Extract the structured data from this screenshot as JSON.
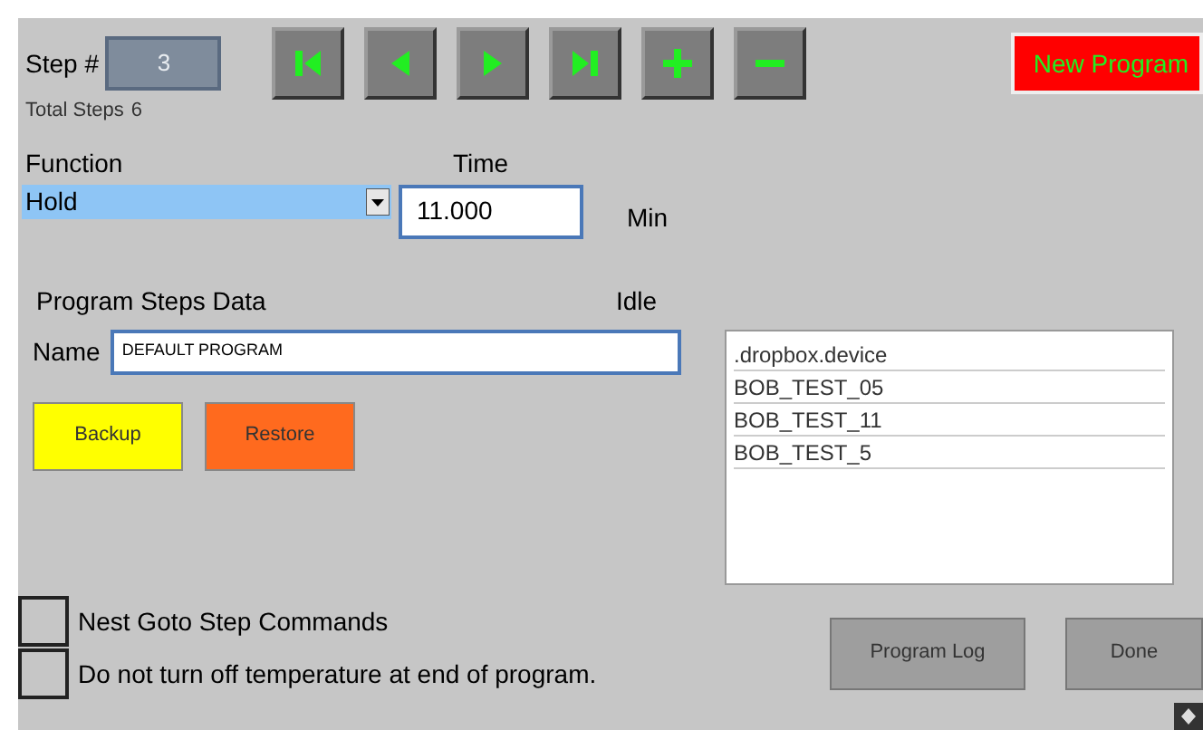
{
  "step": {
    "label": "Step #",
    "value": "3",
    "total_label": "Total Steps",
    "total": "6"
  },
  "nav_buttons": [
    {
      "kind": "first"
    },
    {
      "kind": "prev"
    },
    {
      "kind": "next"
    },
    {
      "kind": "last"
    },
    {
      "kind": "add"
    },
    {
      "kind": "remove"
    }
  ],
  "new_program_button": "New Program",
  "function": {
    "label": "Function",
    "value": "Hold"
  },
  "time": {
    "label": "Time",
    "value": "11.000",
    "unit": "Min"
  },
  "section_title": "Program Steps Data",
  "status": "Idle",
  "name": {
    "label": "Name",
    "value": "DEFAULT PROGRAM"
  },
  "buttons": [
    {
      "label": "Backup",
      "color": "#ffff00"
    },
    {
      "label": "Restore",
      "color": "#ff6a1e"
    }
  ],
  "programs": [
    {
      "label": ".dropbox.device"
    },
    {
      "label": "BOB_TEST_05"
    },
    {
      "label": "BOB_TEST_11"
    },
    {
      "label": "BOB_TEST_5"
    }
  ],
  "options": [
    {
      "label": "Nest Goto Step Commands",
      "checked": false
    },
    {
      "label": "Do not turn off temperature at end of program.",
      "checked": false
    }
  ],
  "footer_buttons": [
    "Program Log",
    "Done"
  ]
}
